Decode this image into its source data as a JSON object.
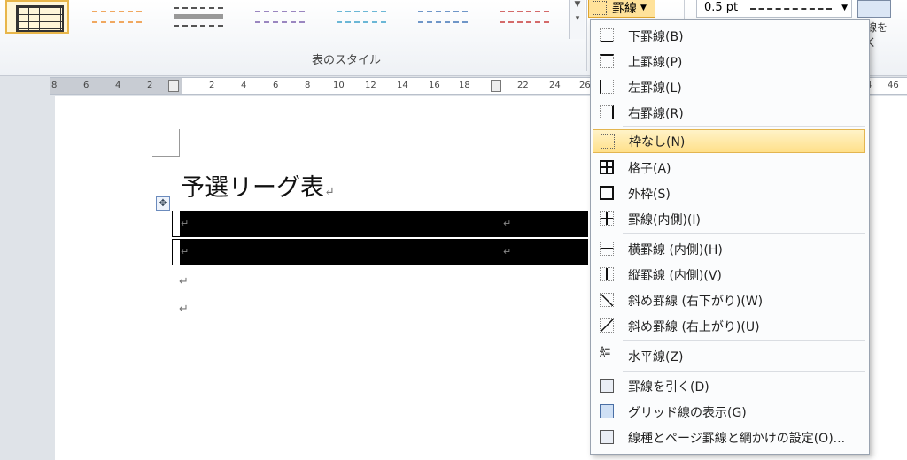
{
  "ribbon": {
    "group_label": "表のスタイル",
    "borders_button_label": "罫線",
    "line_weight": "0.5 pt",
    "draw_table_label_1": "罫線を",
    "draw_table_label_2": "引く",
    "style_colors": [
      "#333333",
      "#f0a860",
      "#555555",
      "#9a86c0",
      "#6bb7d6",
      "#6f96c8",
      "#d46a6a"
    ],
    "accent_color": "#ffe29a"
  },
  "ruler": {
    "left_ticks": [
      "8",
      "6",
      "4",
      "2"
    ],
    "ticks": [
      "2",
      "4",
      "6",
      "8",
      "10",
      "12",
      "14",
      "16",
      "18",
      "22",
      "24",
      "26"
    ],
    "right_ticks": [
      "4",
      "46"
    ]
  },
  "document": {
    "title": "予選リーグ表",
    "paragraph_mark": "↵",
    "move_handle_glyph": "✥"
  },
  "menu": {
    "items": [
      {
        "label": "下罫線(B)",
        "icon": "bottom-border-icon"
      },
      {
        "label": "上罫線(P)",
        "icon": "top-border-icon"
      },
      {
        "label": "左罫線(L)",
        "icon": "left-border-icon"
      },
      {
        "label": "右罫線(R)",
        "icon": "right-border-icon"
      },
      {
        "label": "枠なし(N)",
        "icon": "no-border-icon"
      },
      {
        "label": "格子(A)",
        "icon": "all-borders-icon"
      },
      {
        "label": "外枠(S)",
        "icon": "outside-borders-icon"
      },
      {
        "label": "罫線(内側)(I)",
        "icon": "inside-borders-icon"
      },
      {
        "label": "横罫線 (内側)(H)",
        "icon": "inside-horizontal-border-icon"
      },
      {
        "label": "縦罫線 (内側)(V)",
        "icon": "inside-vertical-border-icon"
      },
      {
        "label": "斜め罫線 (右下がり)(W)",
        "icon": "diagonal-down-border-icon"
      },
      {
        "label": "斜め罫線 (右上がり)(U)",
        "icon": "diagonal-up-border-icon"
      },
      {
        "label": "水平線(Z)",
        "icon": "horizontal-line-icon"
      },
      {
        "label": "罫線を引く(D)",
        "icon": "draw-table-icon"
      },
      {
        "label": "グリッド線の表示(G)",
        "icon": "view-gridlines-icon"
      },
      {
        "label": "線種とページ罫線と網かけの設定(O)...",
        "icon": "borders-and-shading-icon"
      }
    ],
    "highlighted_index": 4
  }
}
